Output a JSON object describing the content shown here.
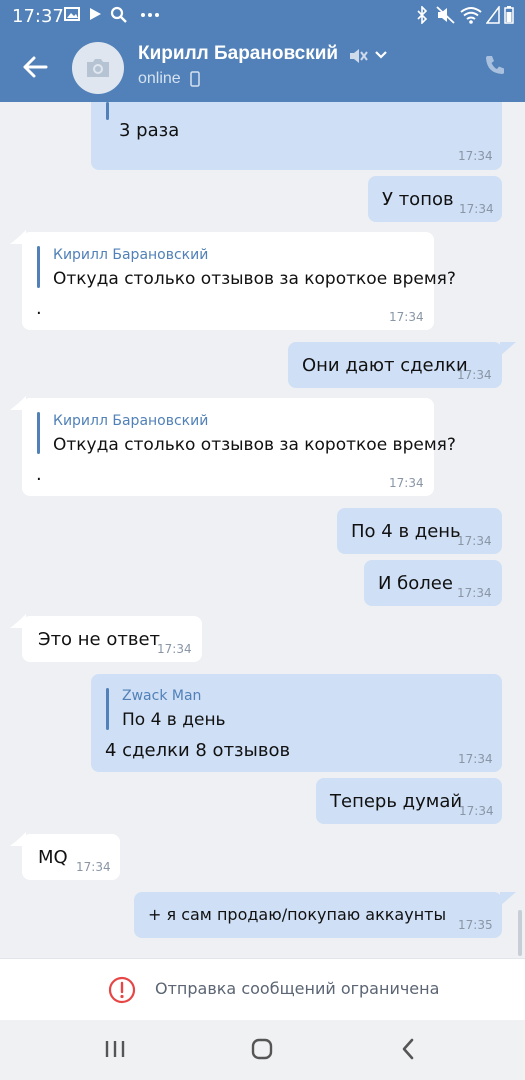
{
  "status_bar": {
    "time": "17:37"
  },
  "header": {
    "title": "Кирилл Барановский",
    "status": "online"
  },
  "messages": [
    {
      "dir": "out",
      "text": "3 раза",
      "time": "17:34"
    },
    {
      "dir": "out",
      "text": "У топов",
      "time": "17:34"
    },
    {
      "dir": "in",
      "reply_name": "Кирилл Барановский",
      "reply_text": "Откуда столько отзывов за короткое время?",
      "text": ".",
      "time": "17:34"
    },
    {
      "dir": "out",
      "text": "Они дают сделки",
      "time": "17:34"
    },
    {
      "dir": "in",
      "reply_name": "Кирилл Барановский",
      "reply_text": "Откуда столько отзывов за короткое время?",
      "text": ".",
      "time": "17:34"
    },
    {
      "dir": "out",
      "text": "По 4 в день",
      "time": "17:34"
    },
    {
      "dir": "out",
      "text": "И более",
      "time": "17:34"
    },
    {
      "dir": "in",
      "text": "Это не ответ",
      "time": "17:34"
    },
    {
      "dir": "out",
      "reply_name": "Zwack Man",
      "reply_text": "По 4 в день",
      "text": "4 сделки 8 отзывов",
      "time": "17:34"
    },
    {
      "dir": "out",
      "text": "Теперь думай",
      "time": "17:34"
    },
    {
      "dir": "in",
      "text": "MQ",
      "time": "17:34"
    },
    {
      "dir": "out",
      "text": "+ я сам продаю/покупаю аккаунты",
      "time": "17:35"
    }
  ],
  "restriction": {
    "text": "Отправка сообщений ограничена"
  },
  "colors": {
    "header": "#5181b8",
    "outgoing": "#cfdff5",
    "incoming": "#ffffff",
    "accent": "#5181b8",
    "warning": "#e64646"
  },
  "icons": {
    "status_left": [
      "image-icon",
      "play-icon",
      "search-icon",
      "more-dots-icon"
    ],
    "status_right": [
      "bluetooth-icon",
      "mute-icon",
      "wifi-icon",
      "signal-icon",
      "battery-icon"
    ],
    "header": [
      "back-arrow-icon",
      "camera-icon",
      "muted-icon",
      "chevron-down-icon",
      "phone-icon"
    ],
    "nav": [
      "recents-icon",
      "home-icon",
      "back-icon"
    ]
  }
}
